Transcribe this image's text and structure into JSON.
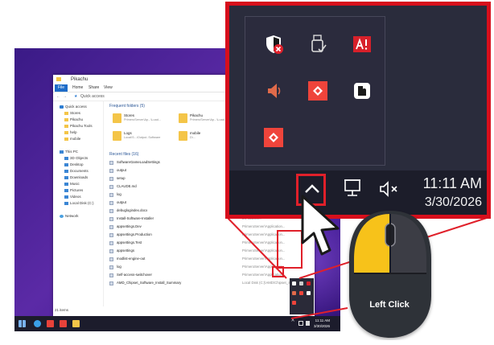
{
  "explorer": {
    "title": "Pikachu",
    "ribbon_tabs": [
      "Home",
      "Share",
      "View"
    ],
    "file_tab": "File",
    "address": "Quick access",
    "nav": [
      {
        "label": "Quick access",
        "type": "star"
      },
      {
        "label": "Stores",
        "type": "folder"
      },
      {
        "label": "Pikachu",
        "type": "folder"
      },
      {
        "label": "Pikachu Tools",
        "type": "folder"
      },
      {
        "label": "help",
        "type": "folder"
      },
      {
        "label": "mobile",
        "type": "folder"
      },
      {
        "label": "This PC",
        "type": "pc"
      },
      {
        "label": "3D Objects",
        "type": "pc"
      },
      {
        "label": "Desktop",
        "type": "pc"
      },
      {
        "label": "Documents",
        "type": "pc"
      },
      {
        "label": "Downloads",
        "type": "pc"
      },
      {
        "label": "Music",
        "type": "pc"
      },
      {
        "label": "Pictures",
        "type": "pc"
      },
      {
        "label": "Videos",
        "type": "pc"
      },
      {
        "label": "Local Disk (C:)",
        "type": "pc"
      },
      {
        "label": "Network",
        "type": "net"
      }
    ],
    "frequent_header": "Frequent folders (5)",
    "frequent": [
      {
        "name": "Stores",
        "path": "PrimeroServer\\Ap...\\Load..."
      },
      {
        "name": "Pikachu",
        "path": "PrimeroServer\\Ap...\\Load..."
      },
      {
        "name": "Logs",
        "path": "Local\\S...\\Output..Software"
      },
      {
        "name": "mobile",
        "path": "D\\..."
      }
    ],
    "recent_header": "Recent files (16)",
    "recent": [
      {
        "name": "SoftwareGameLoadSettings",
        "path": "PrimeroServer\\Ap..."
      },
      {
        "name": "output",
        "path": "D\\output"
      },
      {
        "name": "setup",
        "path": "D\\setup"
      },
      {
        "name": "CLAUDE.md",
        "path": "D\\"
      },
      {
        "name": "log",
        "path": "PrimeroServer\\Ap..."
      },
      {
        "name": "output",
        "path": "D\\Pikachu\\..."
      },
      {
        "name": "debuglogindex.docx",
        "path": "PrimeroServer\\..."
      },
      {
        "name": "Install-Software-Installer",
        "path": "D\\Pikachu\\..."
      },
      {
        "name": "appsettings.Dev",
        "path": "PrimeroServer\\Application..."
      },
      {
        "name": "appsettings.Production",
        "path": "PrimeroServer\\Application..."
      },
      {
        "name": "appsettings.Test",
        "path": "PrimeroServer\\Application..."
      },
      {
        "name": "appsettings",
        "path": "PrimeroServer\\Application..."
      },
      {
        "name": "modlist-engine-out",
        "path": "PrimeroServer\\Application..."
      },
      {
        "name": "log",
        "path": "PrimeroServer\\Application..."
      },
      {
        "name": "Self-access-switchover",
        "path": "PrimeroServer\\Application..."
      },
      {
        "name": "AMD_Chipset_Software_Install_Summary",
        "path": "Local Disk (C:)\\AMD\\Chipset_Software\\..."
      }
    ],
    "status": "21 items"
  },
  "taskbar": {
    "chevron": "^",
    "mini_time": "11:11 AM",
    "mini_date": "3/30/2026"
  },
  "tray": {
    "icons": [
      {
        "name": "windows-security-warning-icon",
        "color": "#ffffff",
        "badge": "#e0202a"
      },
      {
        "name": "usb-safely-remove-icon",
        "color": "#d9d9d9"
      },
      {
        "name": "amd-software-alert-icon",
        "color": "#d7202a"
      },
      {
        "name": "speaker-red-icon",
        "color": "#e06a4a"
      },
      {
        "name": "anydesk-icon",
        "color": "#ef443b"
      },
      {
        "name": "white-tile-app-icon",
        "color": "#ffffff"
      },
      {
        "name": "anydesk-icon",
        "color": "#ef443b"
      }
    ],
    "chevron": "^",
    "time": "11:11 AM",
    "date": "3/30/2026"
  },
  "mouse": {
    "label": "Left Click",
    "highlight_color": "#f7c21a",
    "body_color": "#2f3037"
  },
  "highlight_color": "#e0202a"
}
